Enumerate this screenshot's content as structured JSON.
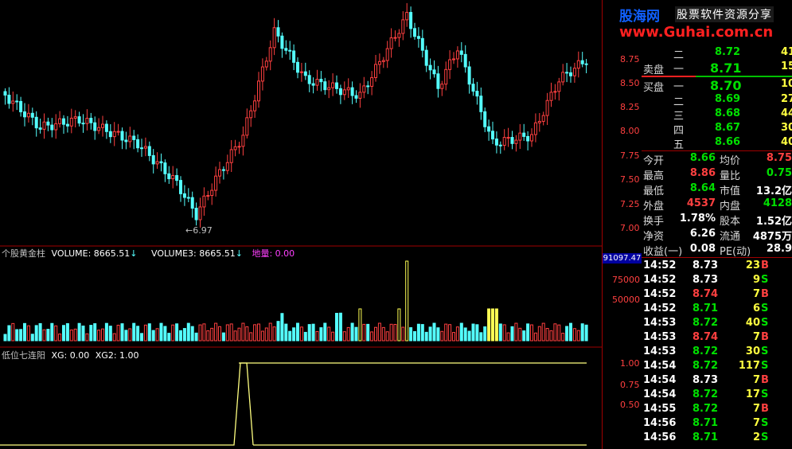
{
  "logo": {
    "site": "股海网",
    "tagline": "股票软件资源分享",
    "url": "www.Guhai.com.cn"
  },
  "price_axis": [
    "8.75",
    "8.50",
    "8.25",
    "8.00",
    "7.75",
    "7.50",
    "7.25",
    "7.00"
  ],
  "low_marker": "6.97",
  "volume_panel": {
    "title": "个股黄金柱",
    "vol_label": "VOLUME: 8665.51",
    "vol3_label": "VOLUME3: 8665.51",
    "diliang_label": "地量: 0.00",
    "max_box": "91097.47",
    "scale": [
      "75000",
      "50000"
    ]
  },
  "indicator_panel": {
    "title": "低位七连阳",
    "xg_label": "XG: 0.00",
    "xg2_label": "XG2: 1.00",
    "scale": [
      "1.00",
      "0.75",
      "0.50"
    ]
  },
  "order_book": {
    "ask_top_level": "二",
    "ask_top_price": "8.72",
    "ask_top_vol": "41",
    "ask_label": "卖盘",
    "ask1_level": "一",
    "ask1_price": "8.71",
    "ask1_vol": "15",
    "bid_label": "买盘",
    "bids": [
      {
        "level": "一",
        "price": "8.70",
        "vol": "10"
      },
      {
        "level": "二",
        "price": "8.69",
        "vol": "27"
      },
      {
        "level": "三",
        "price": "8.68",
        "vol": "44"
      },
      {
        "level": "四",
        "price": "8.67",
        "vol": "30"
      },
      {
        "level": "五",
        "price": "8.66",
        "vol": "40"
      }
    ]
  },
  "stats": [
    {
      "l1": "今开",
      "v1": "8.66",
      "l2": "均价",
      "v2": "8.75"
    },
    {
      "l1": "最高",
      "v1": "8.86",
      "l2": "量比",
      "v2": "0.75"
    },
    {
      "l1": "最低",
      "v1": "8.64",
      "l2": "市值",
      "v2": "13.2亿"
    },
    {
      "l1": "外盘",
      "v1": "4537",
      "l2": "内盘",
      "v2": "4128"
    },
    {
      "l1": "换手",
      "v1": "1.78%",
      "l2": "股本",
      "v2": "1.52亿"
    },
    {
      "l1": "净资",
      "v1": "6.26",
      "l2": "流通",
      "v2": "4875万"
    },
    {
      "l1": "收益(一)",
      "v1": "0.08",
      "l2": "PE(动)",
      "v2": "28.9"
    }
  ],
  "ticks": [
    {
      "time": "14:52",
      "price": "8.73",
      "vol": "23",
      "side": "B"
    },
    {
      "time": "14:52",
      "price": "8.73",
      "vol": "9",
      "side": "S"
    },
    {
      "time": "14:52",
      "price": "8.74",
      "vol": "7",
      "side": "B"
    },
    {
      "time": "14:52",
      "price": "8.71",
      "vol": "6",
      "side": "S"
    },
    {
      "time": "14:53",
      "price": "8.72",
      "vol": "40",
      "side": "S"
    },
    {
      "time": "14:53",
      "price": "8.74",
      "vol": "7",
      "side": "B"
    },
    {
      "time": "14:53",
      "price": "8.72",
      "vol": "30",
      "side": "S"
    },
    {
      "time": "14:54",
      "price": "8.72",
      "vol": "117",
      "side": "S"
    },
    {
      "time": "14:54",
      "price": "8.73",
      "vol": "7",
      "side": "B"
    },
    {
      "time": "14:54",
      "price": "8.72",
      "vol": "17",
      "side": "S"
    },
    {
      "time": "14:55",
      "price": "8.72",
      "vol": "7",
      "side": "B"
    },
    {
      "time": "14:56",
      "price": "8.71",
      "vol": "7",
      "side": "S"
    },
    {
      "time": "14:56",
      "price": "8.71",
      "vol": "2",
      "side": "S"
    }
  ],
  "colors": {
    "up": "#ff4040",
    "down": "#54ffff",
    "golden": "#ffff54",
    "grid": "#a00000"
  }
}
